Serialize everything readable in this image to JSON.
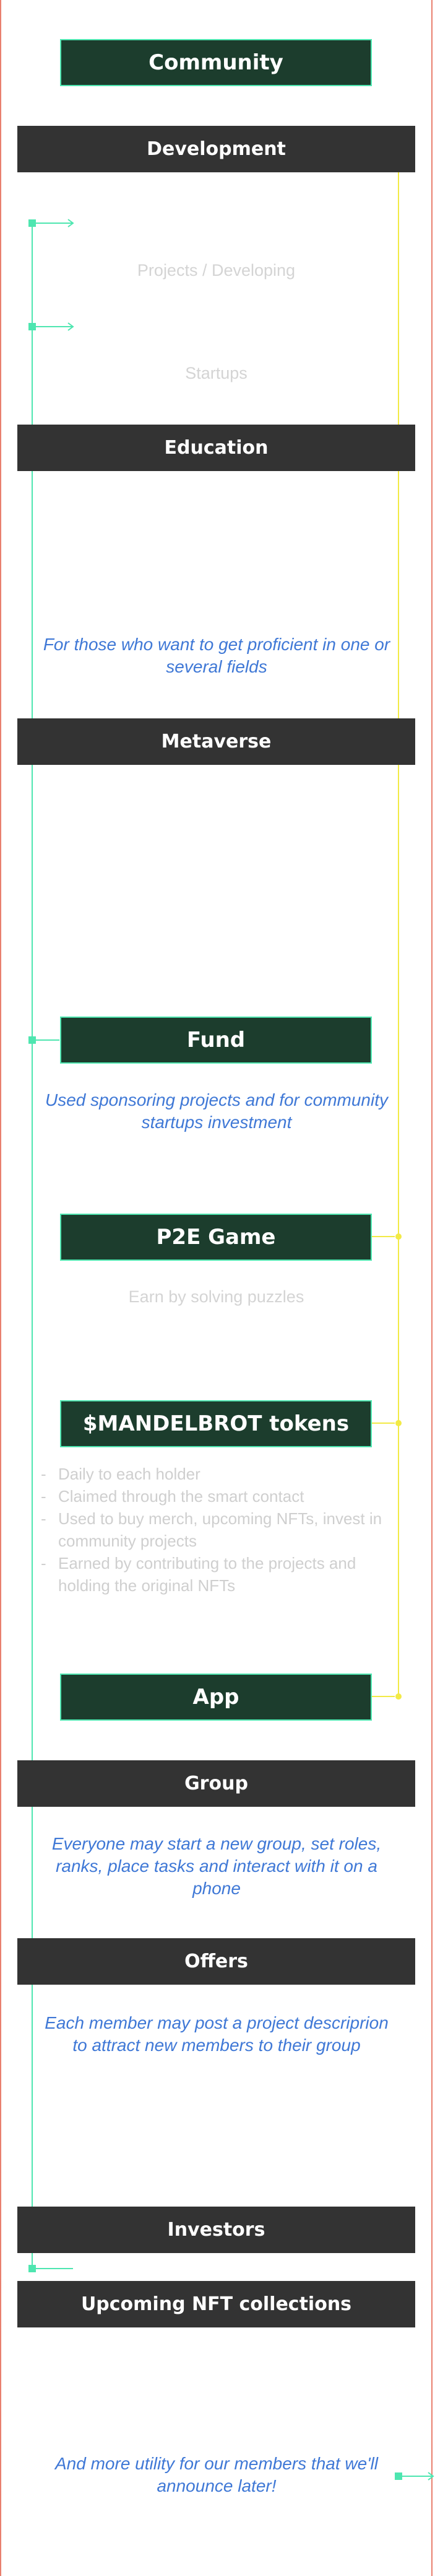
{
  "roadmap": {
    "community": "Community",
    "development": "Development",
    "projects_developing": "Projects / Developing",
    "startups": "Startups",
    "education": "Education",
    "education_desc": "For those who want to get proficient in one or several fields",
    "metaverse": "Metaverse",
    "fund": "Fund",
    "fund_desc": "Used sponsoring projects and for community startups investment",
    "p2e_game": "P2E Game",
    "p2e_desc": "Earn by solving puzzles",
    "tokens": "$MANDELBROT tokens",
    "token_points": [
      "Daily to each holder",
      "Claimed through the smart contact",
      "Used to buy merch, upcoming NFTs, invest in community projects",
      "Earned by contributing to the projects and holding the original NFTs"
    ],
    "app": "App",
    "group": "Group",
    "group_desc": "Everyone may start a new group, set roles, ranks, place tasks and interact with it on a phone",
    "offers": "Offers",
    "offers_desc": "Each member may post a project descriprion to attract new members to their group",
    "investors": "Investors",
    "upcoming_nft": "Upcoming NFT collections",
    "more_utility": "And more utility for our members that we'll announce later!"
  },
  "colors": {
    "connector_green": "#4ee6b0",
    "connector_yellow": "#f2ea45",
    "box_green": "#1c3d2d",
    "box_dark": "#333333",
    "accent_text": "#3f78d6",
    "frame": "#e9806f"
  }
}
